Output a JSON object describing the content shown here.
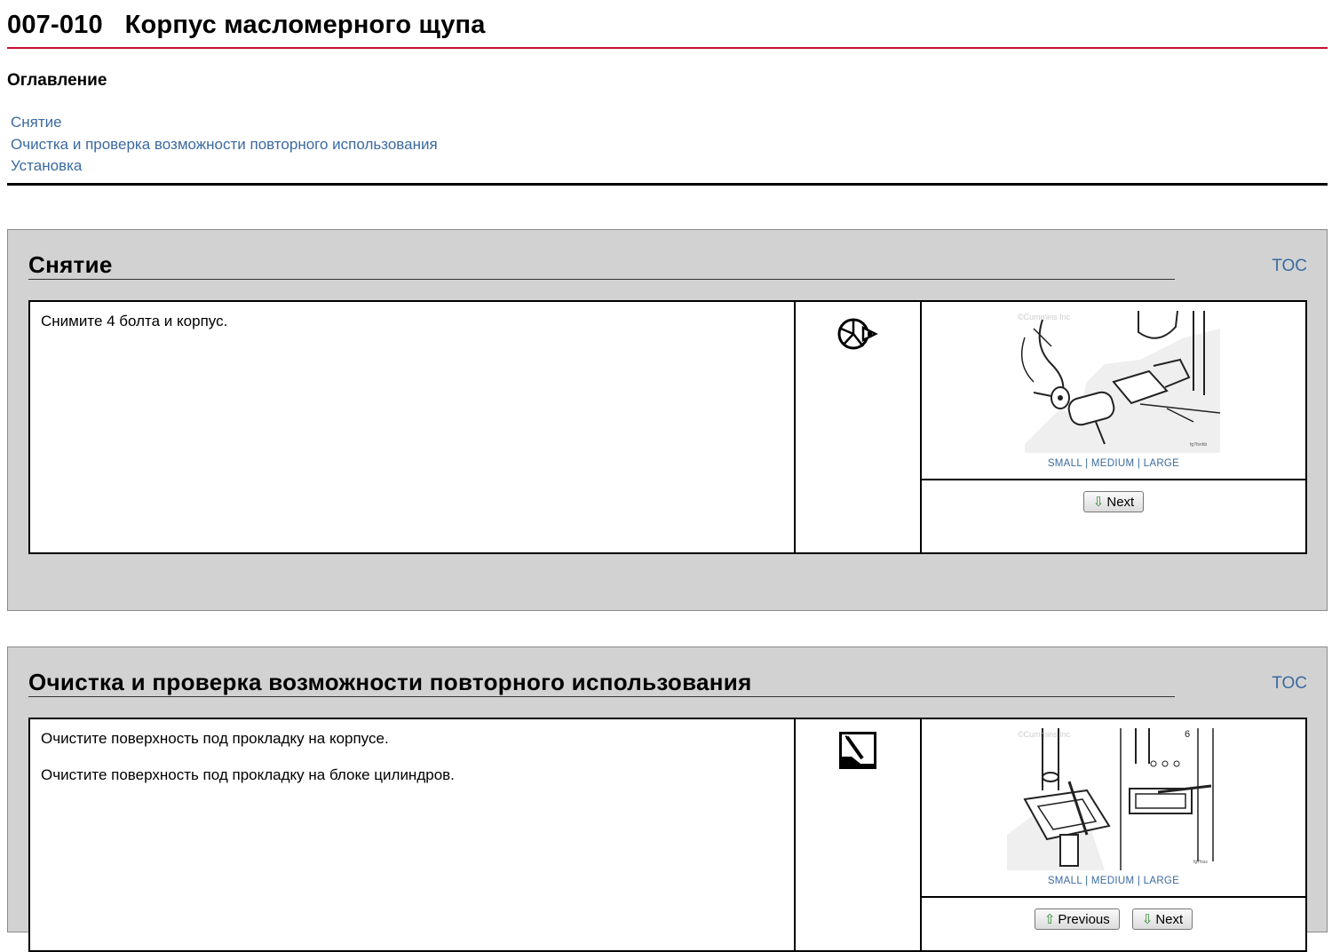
{
  "header": {
    "title": "007-010   Корпус масломерного щупа"
  },
  "toc": {
    "heading": "Оглавление",
    "links": [
      "Снятие",
      "Очистка и проверка возможности повторного использования",
      "Установка"
    ]
  },
  "sections": [
    {
      "title": "Снятие",
      "toc_link": "TOC",
      "step": {
        "paragraphs": [
          "Снимите 4 болта и корпус."
        ],
        "icon": "wrench-socket-icon",
        "figure": {
          "watermark": "©Cummins Inc",
          "code": "fg7fsnhb",
          "size_links": [
            "SMALL",
            "MEDIUM",
            "LARGE"
          ]
        },
        "buttons": [
          "Next"
        ]
      }
    },
    {
      "title": "Очистка и проверка возможности повторного использования",
      "toc_link": "TOC",
      "step": {
        "paragraphs": [
          "Очистите поверхность под прокладку на корпусе.",
          "Очистите поверхность под прокладку на блоке цилиндров."
        ],
        "icon": "gasket-scraper-icon",
        "figure": {
          "watermark": "©Cummins Inc",
          "code": "fg7fsss",
          "size_links": [
            "SMALL",
            "MEDIUM",
            "LARGE"
          ]
        },
        "buttons": [
          "Previous",
          "Next"
        ]
      }
    }
  ],
  "colors": {
    "title_rule": "#c8102e",
    "link": "#3b6aa0",
    "section_bg": "#d2d2d2"
  }
}
